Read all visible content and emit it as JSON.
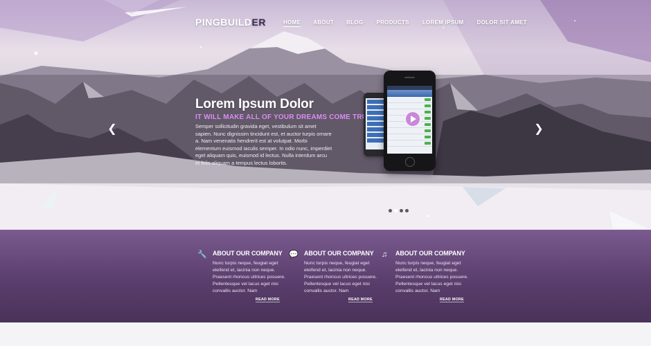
{
  "logo": {
    "main": "PINGBUILD",
    "accent": "ER"
  },
  "nav": [
    {
      "label": "HOME",
      "active": true
    },
    {
      "label": "ABOUT",
      "active": false
    },
    {
      "label": "BLOG",
      "active": false
    },
    {
      "label": "PRODUCTS",
      "active": false
    },
    {
      "label": "LOREM IPSUM",
      "active": false
    },
    {
      "label": "DOLOR SIT AMET",
      "active": false
    }
  ],
  "slider": {
    "title": "Lorem Ipsum Dolor",
    "subtitle": "IT WILL MAKE ALL OF YOUR DREAMS COME TRUE",
    "text": "Semper sollicitudin gravida eget, vestibulum sit amet sapien. Nunc dignissim tincidunt est, et auctor turpis ornare a. Nam venenatis hendrerit est at volutpat. Morbi elementum euismod iaculis semper. In odio nunc, imperdiet eget aliquam quis, euismod id lectus. Nulla interdum arcu et felis aliquam a tempus lectus lobortis.",
    "prev_icon": "chevron-left-icon",
    "next_icon": "chevron-right-icon",
    "dots_count": 4,
    "active_dot": 2
  },
  "features": [
    {
      "icon": "wrench-icon",
      "title": "ABOUT OUR COMPANY",
      "text": "Nunc turpis neque, feugiat eget eleifend et, lacinia non neque. Praesent rhoncus ultrices posuere. Pellentesque vel lacus eget nisi convallis auctor. Nam",
      "more": "READ MORE"
    },
    {
      "icon": "speech-bubble-icon",
      "title": "ABOUT OUR COMPANY",
      "text": "Nunc turpis neque, feugiat eget eleifend et, lacinia non neque. Praesent rhoncus ultrices posuere. Pellentesque vel lacus eget nisi convallis auctor. Nam",
      "more": "READ MORE"
    },
    {
      "icon": "music-note-icon",
      "title": "ABOUT OUR COMPANY",
      "text": "Nunc turpis neque, feugiat eget eleifend et, lacinia non neque. Praesent rhoncus ultrices posuere. Pellentesque vel lacus eget nisi convallis auctor. Nam",
      "more": "READ MORE"
    }
  ],
  "colors": {
    "accent": "#d98cf0",
    "logo_accent": "#3b2a52",
    "feature_band": "#5a3e6d"
  }
}
